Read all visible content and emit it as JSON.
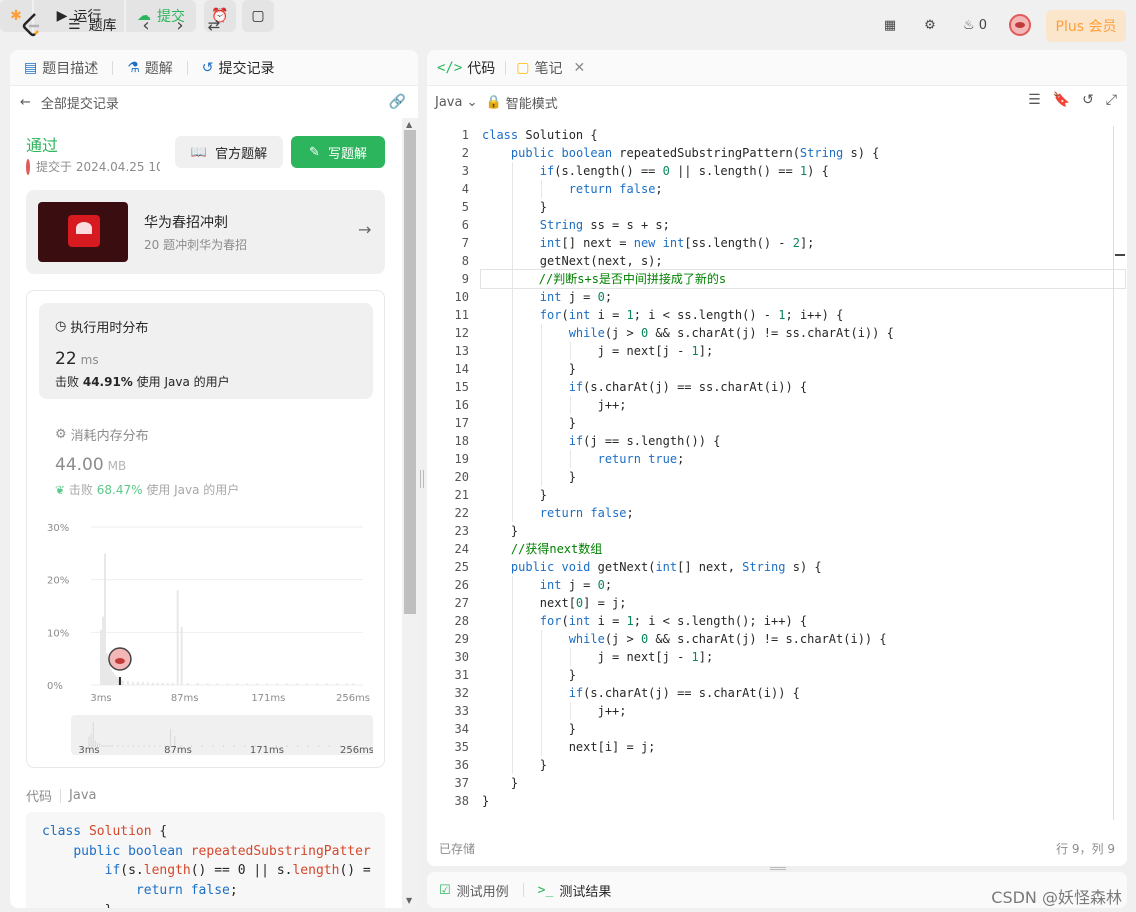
{
  "topbar": {
    "problem_list": "题库",
    "run": "运行",
    "submit": "提交",
    "streak": "0",
    "plus": "Plus 会员"
  },
  "left": {
    "tabs": [
      "题目描述",
      "题解",
      "提交记录"
    ],
    "back": "全部提交记录",
    "status": "通过",
    "submitted_at": "提交于 2024.04.25 10",
    "official_solution": "官方题解",
    "write_solution": "写题解",
    "promo_title": "华为春招冲刺",
    "promo_sub": "20 题冲刺华为春招",
    "promo_logo": "HUAWEI",
    "runtime_title": "执行用时分布",
    "runtime_value": "22",
    "runtime_unit": "ms",
    "runtime_beat_prefix": "击败",
    "runtime_beat": "44.91%",
    "runtime_beat_suffix": "使用 Java 的用户",
    "memory_title": "消耗内存分布",
    "memory_value": "44.00",
    "memory_unit": "MB",
    "memory_beat_prefix": "击败",
    "memory_beat": "68.47%",
    "memory_beat_suffix": "使用 Java 的用户",
    "code_label": "代码",
    "code_lang": "Java"
  },
  "chart_data": {
    "type": "bar",
    "yticks": [
      "30%",
      "20%",
      "10%",
      "0%"
    ],
    "xticks": [
      "3ms",
      "87ms",
      "171ms",
      "256ms"
    ],
    "ylim": [
      0,
      30
    ],
    "highlight_x": "22ms",
    "bars": [
      {
        "x": 3,
        "v": 10.5
      },
      {
        "x": 5,
        "v": 13
      },
      {
        "x": 7,
        "v": 25
      },
      {
        "x": 9,
        "v": 6
      },
      {
        "x": 11,
        "v": 4
      },
      {
        "x": 13,
        "v": 3
      },
      {
        "x": 15,
        "v": 2.5
      },
      {
        "x": 17,
        "v": 2
      },
      {
        "x": 19,
        "v": 1.5
      },
      {
        "x": 21,
        "v": 1.2
      },
      {
        "x": 23,
        "v": 1
      },
      {
        "x": 25,
        "v": 0.8
      },
      {
        "x": 30,
        "v": 0.8
      },
      {
        "x": 35,
        "v": 0.6
      },
      {
        "x": 40,
        "v": 0.6
      },
      {
        "x": 45,
        "v": 0.5
      },
      {
        "x": 50,
        "v": 0.5
      },
      {
        "x": 55,
        "v": 0.4
      },
      {
        "x": 60,
        "v": 0.4
      },
      {
        "x": 65,
        "v": 0.4
      },
      {
        "x": 70,
        "v": 0.4
      },
      {
        "x": 75,
        "v": 0.4
      },
      {
        "x": 80,
        "v": 18
      },
      {
        "x": 84,
        "v": 11
      },
      {
        "x": 90,
        "v": 0.4
      },
      {
        "x": 100,
        "v": 0.4
      },
      {
        "x": 110,
        "v": 0.3
      },
      {
        "x": 120,
        "v": 0.3
      },
      {
        "x": 130,
        "v": 0.3
      },
      {
        "x": 140,
        "v": 0.3
      },
      {
        "x": 150,
        "v": 0.3
      },
      {
        "x": 160,
        "v": 0.3
      },
      {
        "x": 170,
        "v": 0.3
      },
      {
        "x": 180,
        "v": 0.3
      },
      {
        "x": 190,
        "v": 0.3
      },
      {
        "x": 200,
        "v": 0.3
      },
      {
        "x": 210,
        "v": 0.3
      },
      {
        "x": 220,
        "v": 0.3
      },
      {
        "x": 230,
        "v": 0.3
      },
      {
        "x": 240,
        "v": 0.3
      },
      {
        "x": 250,
        "v": 0.3
      },
      {
        "x": 256,
        "v": 0.3
      }
    ]
  },
  "code_preview": [
    "class Solution {",
    "    public boolean repeatedSubstringPatter",
    "        if(s.length() == 0 || s.length() =",
    "            return false;",
    "        }"
  ],
  "right": {
    "tab_code": "代码",
    "tab_notes": "笔记",
    "language": "Java",
    "mode": "智能模式",
    "saved": "已存储",
    "cursor": "行 9，列 9"
  },
  "code_lines": [
    "class Solution {",
    "    public boolean repeatedSubstringPattern(String s) {",
    "        if(s.length() == 0 || s.length() == 1) {",
    "            return false;",
    "        }",
    "        String ss = s + s;",
    "        int[] next = new int[ss.length() - 2];",
    "        getNext(next, s);",
    "        //判断s+s是否中间拼接成了新的s",
    "        int j = 0;",
    "        for(int i = 1; i < ss.length() - 1; i++) {",
    "            while(j > 0 && s.charAt(j) != ss.charAt(i)) {",
    "                j = next[j - 1];",
    "            }",
    "            if(s.charAt(j) == ss.charAt(i)) {",
    "                j++;",
    "            }",
    "            if(j == s.length()) {",
    "                return true;",
    "            }",
    "        }",
    "        return false;",
    "    }",
    "    //获得next数组",
    "    public void getNext(int[] next, String s) {",
    "        int j = 0;",
    "        next[0] = j;",
    "        for(int i = 1; i < s.length(); i++) {",
    "            while(j > 0 && s.charAt(j) != s.charAt(i)) {",
    "                j = next[j - 1];",
    "            }",
    "            if(s.charAt(j) == s.charAt(i)) {",
    "                j++;",
    "            }",
    "            next[i] = j;",
    "        }",
    "    }",
    "}"
  ],
  "bottom": {
    "testcase": "测试用例",
    "result": "测试结果"
  },
  "watermark": "CSDN @妖怪森林"
}
